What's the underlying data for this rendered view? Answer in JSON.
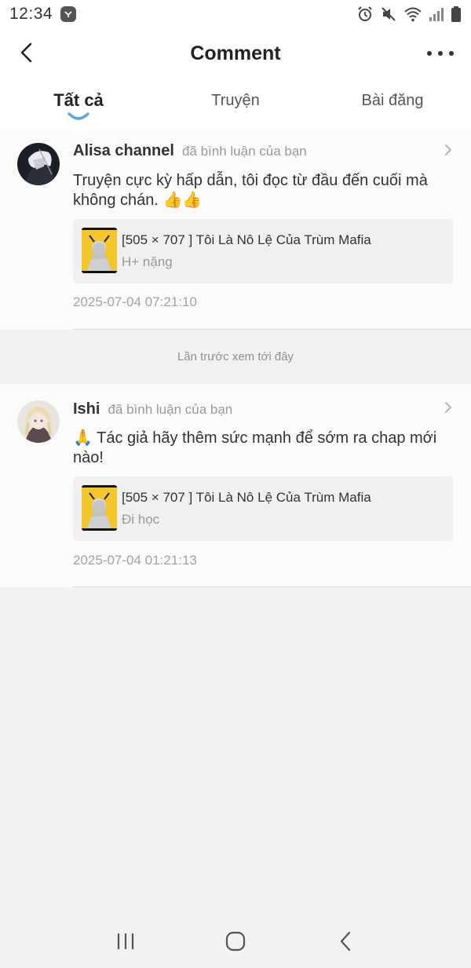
{
  "status_bar": {
    "time": "12:34",
    "icons": [
      "app-notification-icon",
      "alarm-icon",
      "mute-icon",
      "wifi-icon",
      "signal-icon",
      "battery-icon"
    ]
  },
  "header": {
    "title": "Comment",
    "back_icon": "chevron-left-icon",
    "more_icon": "more-dots-icon"
  },
  "tabs": [
    {
      "label": "Tất cả",
      "active": true
    },
    {
      "label": "Truyện",
      "active": false
    },
    {
      "label": "Bài đăng",
      "active": false
    }
  ],
  "comments": [
    {
      "user": "Alisa channel",
      "action": "đã bình luận của bạn",
      "text": "Truyện cực kỳ hấp dẫn, tôi đọc từ đầu đến cuối mà không chán. 👍👍",
      "ref_title": "[505 × 707 ] Tôi Là Nô Lệ Của Trùm Mafia",
      "ref_sub": "H+ nặng",
      "time": "2025-07-04 07:21:10"
    },
    {
      "user": "Ishi",
      "action": "đã bình luận của bạn",
      "text": "🙏 Tác giả hãy thêm sức mạnh để sớm ra chap mới nào!",
      "ref_title": "[505 × 707 ] Tôi Là Nô Lệ Của Trùm Mafia",
      "ref_sub": "Đi học",
      "time": "2025-07-04 01:21:13"
    }
  ],
  "last_seen_label": "Lần trước xem tới đây",
  "nav_bar": [
    "recent-apps-icon",
    "home-icon",
    "back-icon"
  ],
  "colors": {
    "accent": "#5aa9e6",
    "background": "#f2f2f3",
    "card": "#fbfbfb",
    "muted_text": "#9a9a9a"
  }
}
